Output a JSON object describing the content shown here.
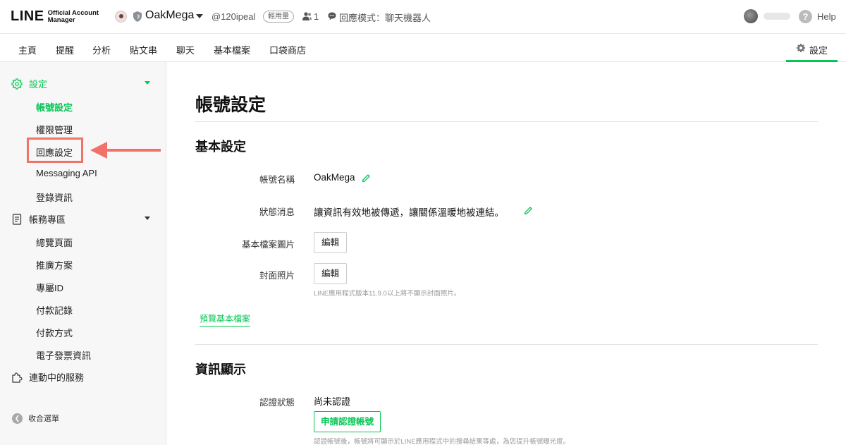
{
  "app": {
    "logo_main": "LINE",
    "logo_sub_line1": "Official Account",
    "logo_sub_line2": "Manager"
  },
  "account": {
    "name": "OakMega",
    "id": "@120ipeal",
    "plan_badge": "輕用量",
    "friends_count": "1",
    "reply_mode": "回應模式：聊天機器人"
  },
  "header": {
    "help_label": "Help"
  },
  "tabs": [
    {
      "label": "主頁"
    },
    {
      "label": "提醒"
    },
    {
      "label": "分析"
    },
    {
      "label": "貼文串"
    },
    {
      "label": "聊天"
    },
    {
      "label": "基本檔案"
    },
    {
      "label": "口袋商店"
    }
  ],
  "settings_tab": {
    "label": "設定"
  },
  "sidebar": {
    "groups": [
      {
        "label": "設定",
        "active": true,
        "items": [
          {
            "label": "帳號設定",
            "active": true
          },
          {
            "label": "權限管理"
          },
          {
            "label": "回應設定"
          },
          {
            "label": "Messaging API"
          },
          {
            "label": "登錄資訊"
          }
        ]
      },
      {
        "label": "帳務專區",
        "items": [
          {
            "label": "總覽頁面"
          },
          {
            "label": "推廣方案"
          },
          {
            "label": "專屬ID"
          },
          {
            "label": "付款記錄"
          },
          {
            "label": "付款方式"
          },
          {
            "label": "電子發票資訊"
          }
        ]
      },
      {
        "label": "連動中的服務"
      }
    ],
    "collapse_label": "收合選單"
  },
  "main": {
    "page_title": "帳號設定",
    "basic": {
      "title": "基本設定",
      "account_name_label": "帳號名稱",
      "account_name_value": "OakMega",
      "status_label": "狀態消息",
      "status_value": "讓資訊有效地被傳遞，讓關係溫暖地被連結。",
      "profile_image_label": "基本檔案圖片",
      "profile_image_button": "編輯",
      "cover_label": "封面照片",
      "cover_button": "編輯",
      "cover_note": "LINE應用程式版本11.9.0以上將不顯示封面照片。",
      "preview_link": "預覽基本檔案"
    },
    "info": {
      "title": "資訊顯示",
      "verify_label": "認證狀態",
      "verify_value": "尚未認證",
      "verify_button": "申請認證帳號",
      "verify_note": "認證帳號後，帳號將可顯示於LINE應用程式中的搜尋結果等處，為您提升帳號曝光度。"
    }
  },
  "colors": {
    "accent": "#06c755",
    "annotation": "#f07268"
  }
}
